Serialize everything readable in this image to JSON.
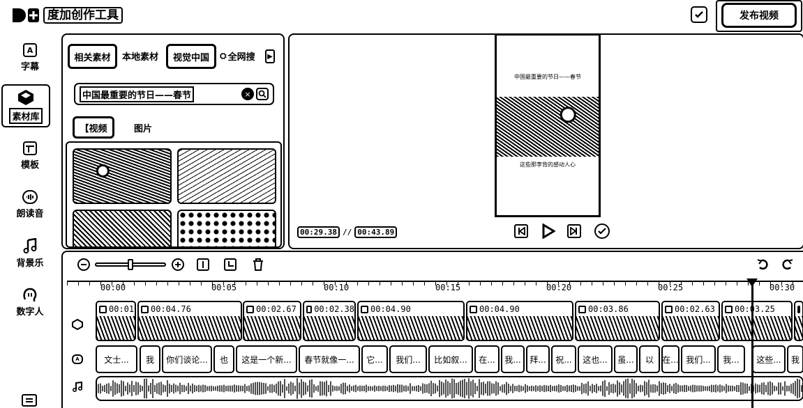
{
  "app": {
    "title": "度加创作工具"
  },
  "header": {
    "publish_label": "发布视频"
  },
  "sidebar": {
    "items": [
      {
        "label": "字幕",
        "icon": "subtitle-icon"
      },
      {
        "label": "素材库",
        "icon": "cube-icon",
        "active": true
      },
      {
        "label": "模板",
        "icon": "template-icon"
      },
      {
        "label": "朗读音",
        "icon": "voice-icon"
      },
      {
        "label": "背景乐",
        "icon": "music-note-icon"
      },
      {
        "label": "数字人",
        "icon": "digital-human-icon"
      }
    ]
  },
  "materials": {
    "tabs": [
      {
        "label": "相关素材",
        "active": true
      },
      {
        "label": "本地素材",
        "active": false
      },
      {
        "label": "视觉中国",
        "active": false
      },
      {
        "label": "全网搜",
        "active": false
      }
    ],
    "search_value": "中国最重要的节日——春节",
    "type_tabs": [
      {
        "label": "【视频",
        "active": true
      },
      {
        "label": "图片",
        "active": false
      }
    ]
  },
  "preview": {
    "title_text": "中国最重要的节日——春节",
    "caption_text": "这些那李背的感动人心",
    "current_time": "00:29.38",
    "separator": "//",
    "total_time": "00:43.89"
  },
  "timeline": {
    "ruler": [
      "00:00",
      "00:05",
      "00:10",
      "00:15",
      "00:20",
      "00:25",
      "00:30"
    ],
    "clips": [
      "00:01",
      "00:04.76",
      "00:02.67",
      "00:02.38",
      "00:04.90",
      "00:04.90",
      "00:03.86",
      "00:02.63",
      "00:03.25",
      ""
    ],
    "subtitles": [
      "文士...",
      "我",
      "你们谈论...",
      "也",
      "这是一个新...",
      "春节就像一...",
      "它...",
      "我们...",
      "比如叙...",
      "在...",
      "我...",
      "拜...",
      "祝...",
      "这也...",
      "虽...",
      "以",
      "在...",
      "我们...",
      "我...",
      "这些...",
      "我"
    ]
  },
  "colors": {
    "ink": "#000000",
    "paper": "#ffffff"
  }
}
